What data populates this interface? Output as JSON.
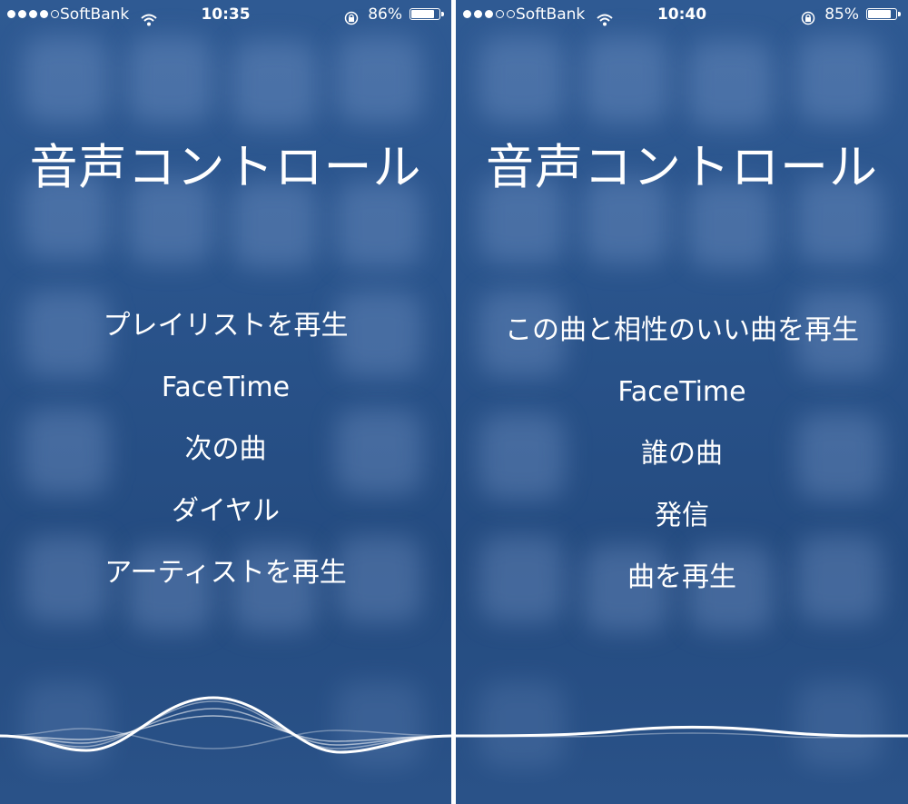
{
  "screens": [
    {
      "status": {
        "carrier": "SoftBank",
        "time": "10:35",
        "battery_text": "86%",
        "battery_level": 0.86,
        "signal_bars": 4
      },
      "title": "音声コントロール",
      "commands": [
        "プレイリストを再生",
        "FaceTime",
        "次の曲",
        "ダイヤル",
        "アーティストを再生"
      ]
    },
    {
      "status": {
        "carrier": "SoftBank",
        "time": "10:40",
        "battery_text": "85%",
        "battery_level": 0.85,
        "signal_bars": 3
      },
      "title": "音声コントロール",
      "commands": [
        "この曲と相性のいい曲を再生",
        "FaceTime",
        "誰の曲",
        "発信",
        "曲を再生"
      ]
    }
  ],
  "colors": {
    "background": "#2c558c",
    "text": "#ffffff"
  }
}
